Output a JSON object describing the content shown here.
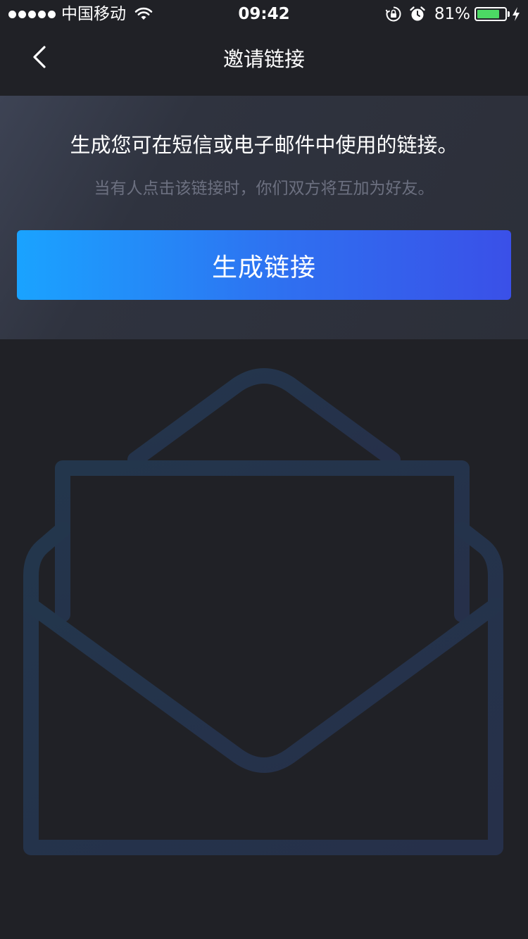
{
  "status_bar": {
    "carrier": "中国移动",
    "time": "09:42",
    "battery_percent": "81%",
    "battery_level": 0.81,
    "battery_color": "#4cd964"
  },
  "nav": {
    "back_icon": "chevron-left-icon",
    "title": "邀请链接"
  },
  "promo": {
    "heading": "生成您可在短信或电子邮件中使用的链接。",
    "subtext": "当有人点击该链接时，你们双方将互加为好友。",
    "button_label": "生成链接",
    "button_gradient": [
      "#1aa3ff",
      "#3a50e8"
    ]
  },
  "illustration": {
    "icon": "envelope-plus-icon",
    "stroke_color": "#283a52"
  }
}
